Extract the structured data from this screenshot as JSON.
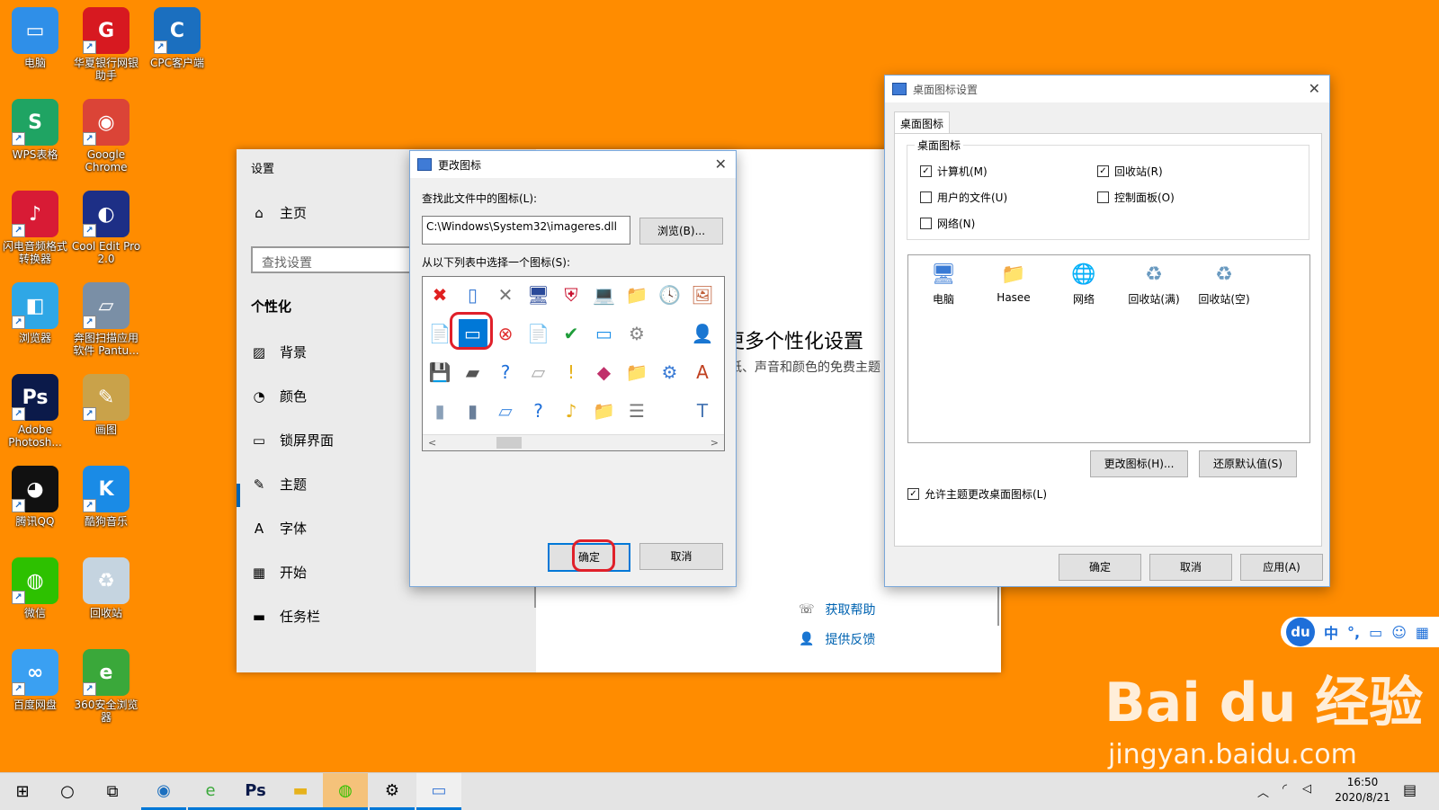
{
  "desktop_icons": [
    {
      "label": "电脑",
      "icon": "computer-icon",
      "color": "#2f8fe8",
      "glyph": "▭"
    },
    {
      "label": "华夏银行网银助手",
      "icon": "huaxia-bank-icon",
      "color": "#d71920",
      "glyph": "G"
    },
    {
      "label": "CPC客户端",
      "icon": "cpc-client-icon",
      "color": "#1b6fbf",
      "glyph": "C"
    },
    {
      "label": "WPS表格",
      "icon": "wps-sheet-icon",
      "color": "#1fa463",
      "glyph": "S"
    },
    {
      "label": "Google Chrome",
      "icon": "chrome-icon",
      "color": "#db4437",
      "glyph": "◉"
    },
    {
      "label": "闪电音频格式转换器",
      "icon": "audio-converter-icon",
      "color": "#d81b35",
      "glyph": "♪"
    },
    {
      "label": "Cool Edit Pro 2.0",
      "icon": "cool-edit-icon",
      "color": "#1d2f86",
      "glyph": "◐"
    },
    {
      "label": "浏览器",
      "icon": "browser-icon",
      "color": "#2fa7e6",
      "glyph": "◧"
    },
    {
      "label": "奔图扫描应用软件 Pantu...",
      "icon": "scanner-icon",
      "color": "#7a8fa6",
      "glyph": "▱"
    },
    {
      "label": "Adobe Photosh...",
      "icon": "photoshop-icon",
      "color": "#0b1a4a",
      "glyph": "Ps"
    },
    {
      "label": "画图",
      "icon": "paint-icon",
      "color": "#c9a24a",
      "glyph": "✎"
    },
    {
      "label": "腾讯QQ",
      "icon": "qq-icon",
      "color": "#111111",
      "glyph": "◕"
    },
    {
      "label": "酷狗音乐",
      "icon": "kugou-icon",
      "color": "#1a8be6",
      "glyph": "K"
    },
    {
      "label": "微信",
      "icon": "wechat-icon",
      "color": "#2dc100",
      "glyph": "◍"
    },
    {
      "label": "回收站",
      "icon": "recycle-bin-icon",
      "color": "#c5d4e0",
      "glyph": "♻"
    },
    {
      "label": "百度网盘",
      "icon": "baidu-netdisk-icon",
      "color": "#3aa0f2",
      "glyph": "∞"
    },
    {
      "label": "360安全浏览器",
      "icon": "360-browser-icon",
      "color": "#3aa83a",
      "glyph": "e"
    }
  ],
  "settings": {
    "title": "设置",
    "home": "主页",
    "search_placeholder": "查找设置",
    "section": "个性化",
    "nav": [
      {
        "label": "背景",
        "icon": "background-icon",
        "glyph": "▨"
      },
      {
        "label": "颜色",
        "icon": "palette-icon",
        "glyph": "◔"
      },
      {
        "label": "锁屏界面",
        "icon": "lock-screen-icon",
        "glyph": "▭"
      },
      {
        "label": "主题",
        "icon": "theme-icon",
        "glyph": "✎"
      },
      {
        "label": "字体",
        "icon": "font-icon",
        "glyph": "A"
      },
      {
        "label": "开始",
        "icon": "start-icon",
        "glyph": "▦"
      },
      {
        "label": "任务栏",
        "icon": "taskbar-icon",
        "glyph": "▬"
      }
    ],
    "heading_partial": "更多个性化设置",
    "desc_partial": "纸、声音和颜色的免费主题",
    "links": {
      "help": "获取帮助",
      "feedback": "提供反馈"
    }
  },
  "change_icon": {
    "title": "更改图标",
    "file_label": "查找此文件中的图标(L):",
    "path": "C:\\Windows\\System32\\imageres.dll",
    "browse": "浏览(B)...",
    "list_label": "从以下列表中选择一个图标(S):",
    "ok": "确定",
    "cancel": "取消",
    "icons": [
      "✖",
      "▯",
      "✕",
      "🖥",
      "⛨",
      "💻",
      "📁",
      "🕓",
      "🖼",
      "📄",
      "▭",
      "⊗",
      "📄",
      "✔",
      "▭",
      "⚙",
      "",
      "👤",
      "💾",
      "▰",
      "?",
      "▱",
      "!",
      "◆",
      "📁",
      "⚙",
      "A",
      "▮",
      "▮",
      "▱",
      "?",
      "♪",
      "📁",
      "☰",
      "",
      "T"
    ]
  },
  "desktop_icon_settings": {
    "title": "桌面图标设置",
    "tab": "桌面图标",
    "group": "桌面图标",
    "checks": [
      {
        "label": "计算机(M)",
        "checked": true
      },
      {
        "label": "回收站(R)",
        "checked": true
      },
      {
        "label": "用户的文件(U)",
        "checked": false
      },
      {
        "label": "控制面板(O)",
        "checked": false
      },
      {
        "label": "网络(N)",
        "checked": false
      }
    ],
    "preview": [
      {
        "label": "电脑",
        "glyph": "🖥"
      },
      {
        "label": "Hasee",
        "glyph": "📁"
      },
      {
        "label": "网络",
        "glyph": "🌐"
      },
      {
        "label": "回收站(满)",
        "glyph": "♻"
      },
      {
        "label": "回收站(空)",
        "glyph": "♻"
      }
    ],
    "change_icon": "更改图标(H)...",
    "restore": "还原默认值(S)",
    "allow_theme": "允许主题更改桌面图标(L)",
    "ok": "确定",
    "cancel": "取消",
    "apply": "应用(A)"
  },
  "ime": {
    "badge": "du",
    "mode": "中",
    "punct": "°,"
  },
  "watermark": {
    "brand": "Bai du 经验",
    "url": "jingyan.baidu.com"
  },
  "taskbar": {
    "time": "16:50",
    "date": "2020/8/21"
  }
}
